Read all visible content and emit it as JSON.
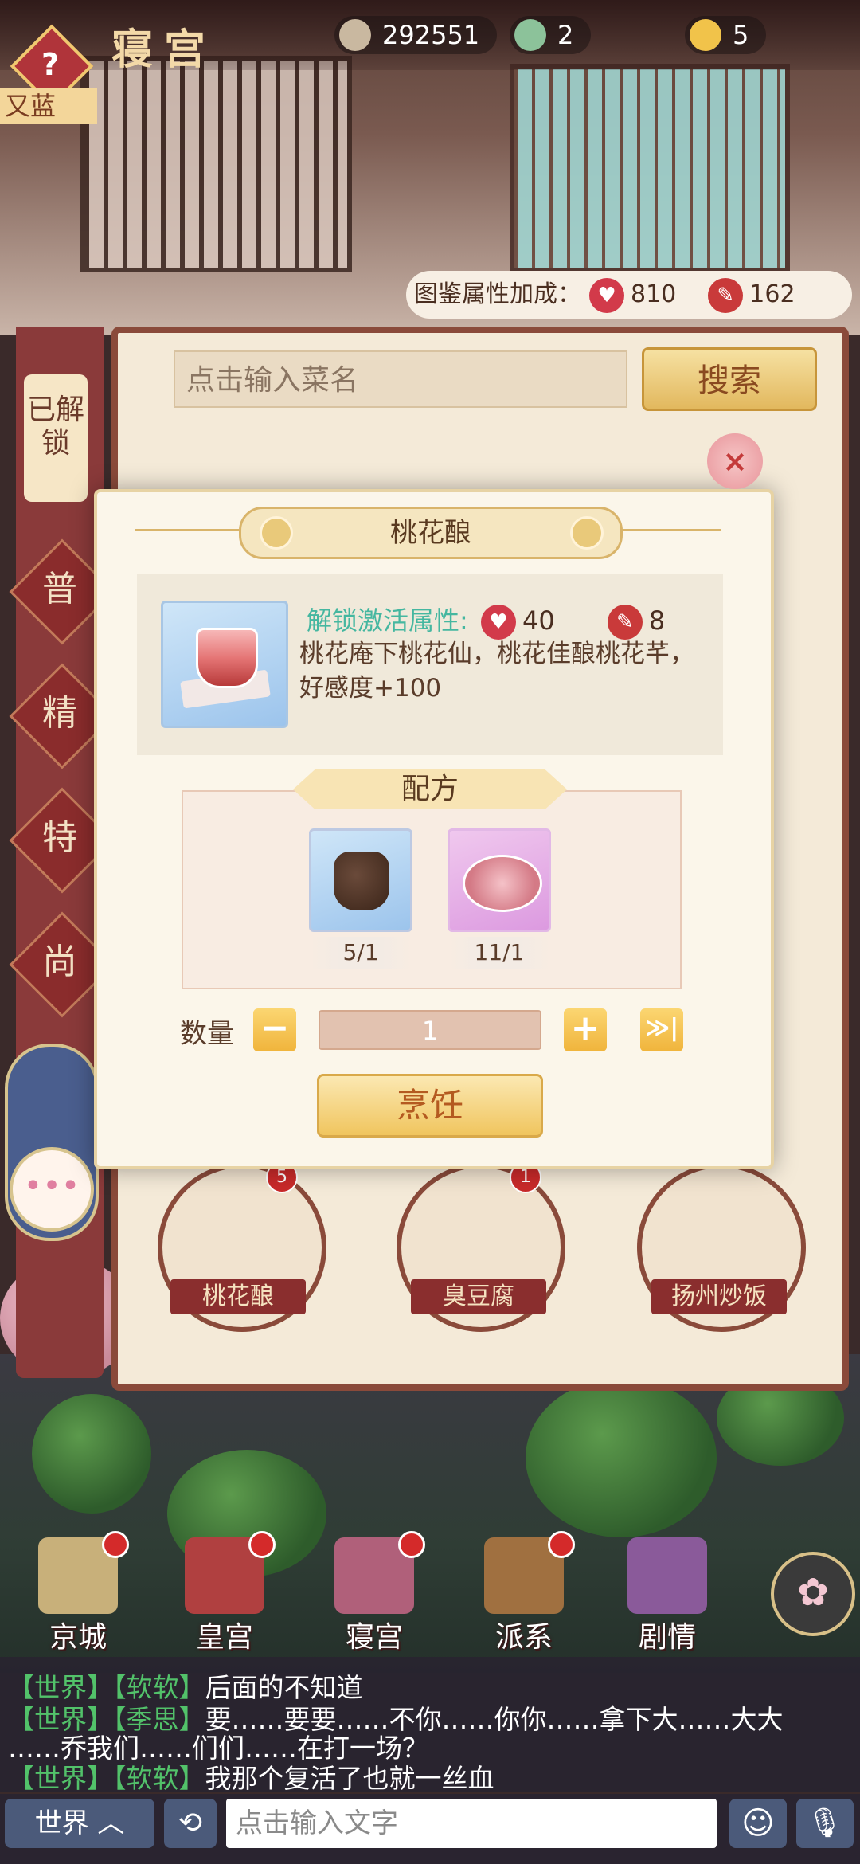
{
  "header": {
    "title": "寝宫",
    "coins": "292551",
    "jade": "2",
    "gold": "5",
    "help_label": "?",
    "name_tag": "又蓝"
  },
  "collection_bonus": {
    "label": "图鉴属性加成：",
    "charm": "810",
    "talent": "162"
  },
  "search": {
    "placeholder": "点击输入菜名",
    "button": "搜索"
  },
  "sidebar": {
    "unlocked": "已解锁",
    "tabs": [
      "普",
      "精",
      "特",
      "尚"
    ]
  },
  "dish_list": [
    {
      "name": "桃花酿",
      "badge": "5"
    },
    {
      "name": "臭豆腐",
      "badge": "1"
    },
    {
      "name": "扬州炒饭",
      "badge": ""
    }
  ],
  "modal": {
    "title": "桃花酿",
    "unlock_label": "解锁激活属性:",
    "charm": "40",
    "talent": "8",
    "description": "桃花庵下桃花仙，桃花佳酿桃花芊，好感度+100",
    "recipe_title": "配方",
    "ingredients": [
      {
        "name": "peach-wine-jar",
        "count": "5/1"
      },
      {
        "name": "peach-blossom-plate",
        "count": "11/1"
      }
    ],
    "quantity_label": "数量",
    "quantity": "1",
    "minus": "−",
    "plus": "+",
    "max": "≫|",
    "cook_button": "烹饪",
    "close": "×"
  },
  "nav": [
    {
      "label": "京城",
      "icon": "map-icon",
      "color": "#c8b07a"
    },
    {
      "label": "皇宫",
      "icon": "palace-icon",
      "color": "#b04040"
    },
    {
      "label": "寝宫",
      "icon": "bedchamber-icon",
      "color": "#b0607a"
    },
    {
      "label": "派系",
      "icon": "faction-icon",
      "color": "#a07040"
    },
    {
      "label": "剧情",
      "icon": "story-book-icon",
      "color": "#8a5a9a"
    }
  ],
  "chat": {
    "lines": [
      {
        "channel": "【世界】",
        "name": "【软软】",
        "text": "后面的不知道"
      },
      {
        "channel": "【世界】",
        "name": "【季思】",
        "text": "要……要要……不你……你你……拿下大……大大"
      },
      {
        "channel": "",
        "name": "",
        "text": "……乔我们……们们……在打一场？"
      },
      {
        "channel": "【世界】",
        "name": "【软软】",
        "text": "我那个复活了也就一丝血"
      }
    ],
    "channel_button": "世界 ︿",
    "input_placeholder": "点击输入文字",
    "history_icon": "⟲",
    "emoji_icon": "☺",
    "mic_icon": "🎙"
  },
  "colors": {
    "accent_teal": "#45b7a0",
    "chat_green": "#52c26a",
    "panel_brown": "#8a4a3a"
  }
}
